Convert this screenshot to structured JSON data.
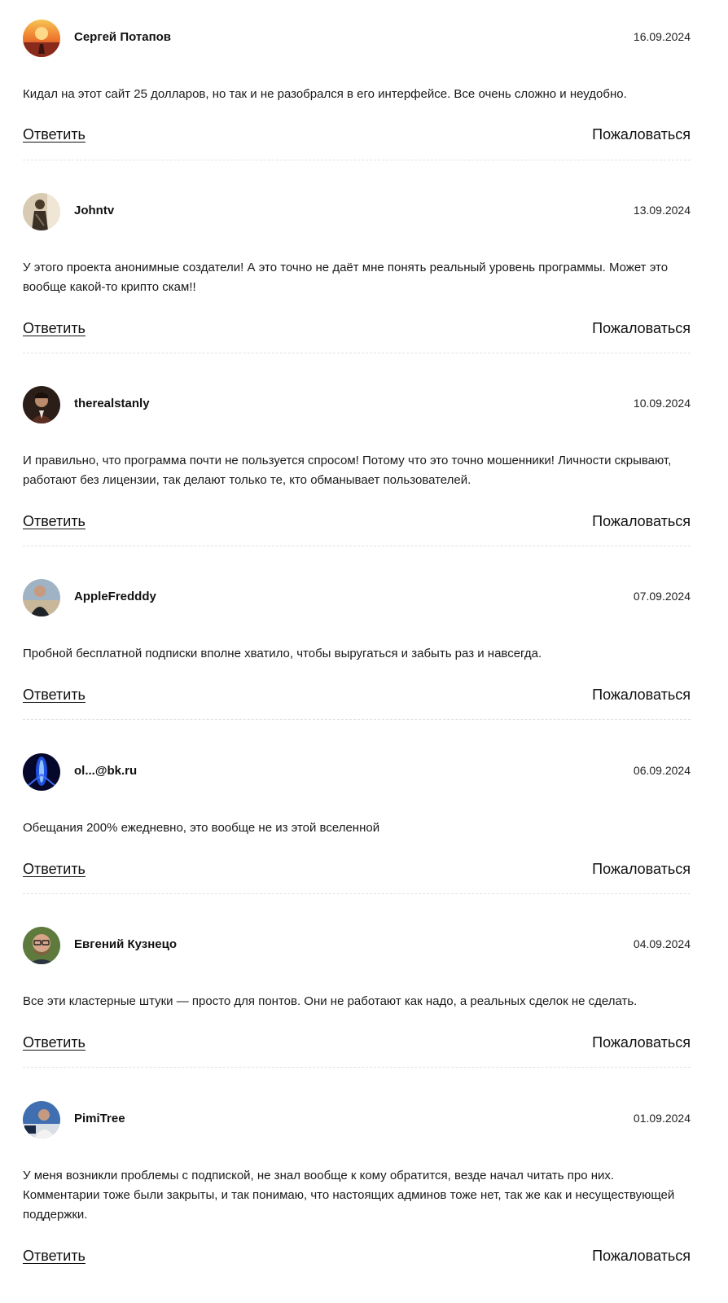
{
  "reviews": [
    {
      "author": "Сергей Потапов",
      "date": "16.09.2024",
      "text": "Кидал на этот сайт 25 долларов, но так и не разобрался в его интерфейсе. Все очень сложно и неудобно.",
      "reply_label": "Ответить",
      "report_label": "Пожаловаться"
    },
    {
      "author": "Johntv",
      "date": "13.09.2024",
      "text": "У этого проекта анонимные создатели! А это точно не даёт мне понять реальный уровень программы. Может это вообще какой-то крипто скам!!",
      "reply_label": "Ответить",
      "report_label": "Пожаловаться"
    },
    {
      "author": "therealstanly",
      "date": "10.09.2024",
      "text": "И правильно, что программа почти не пользуется спросом! Потому что это точно мошенники! Личности скрывают, работают без лицензии, так делают только те, кто обманывает пользователей.",
      "reply_label": "Ответить",
      "report_label": "Пожаловаться"
    },
    {
      "author": "AppleFredddy",
      "date": "07.09.2024",
      "text": "Пробной бесплатной подписки вполне хватило, чтобы выругаться и забыть раз и навсегда.",
      "reply_label": "Ответить",
      "report_label": "Пожаловаться"
    },
    {
      "author": "ol...@bk.ru",
      "date": "06.09.2024",
      "text": "Обещания 200% ежедневно, это вообще не из этой вселенной",
      "reply_label": "Ответить",
      "report_label": "Пожаловаться"
    },
    {
      "author": "Евгений Кузнецо",
      "date": "04.09.2024",
      "text": "Все эти кластерные штуки — просто для понтов. Они не работают как надо, а реальных сделок не сделать.",
      "reply_label": "Ответить",
      "report_label": "Пожаловаться"
    },
    {
      "author": "PimiTree",
      "date": "01.09.2024",
      "text": "У меня возникли проблемы с подпиской, не знал вообще к кому обратится, везде начал читать про них. Комментарии тоже были закрыты, и так понимаю, что настоящих админов тоже нет, так же как и несуществующей поддержки.",
      "reply_label": "Ответить",
      "report_label": "Пожаловаться"
    }
  ]
}
